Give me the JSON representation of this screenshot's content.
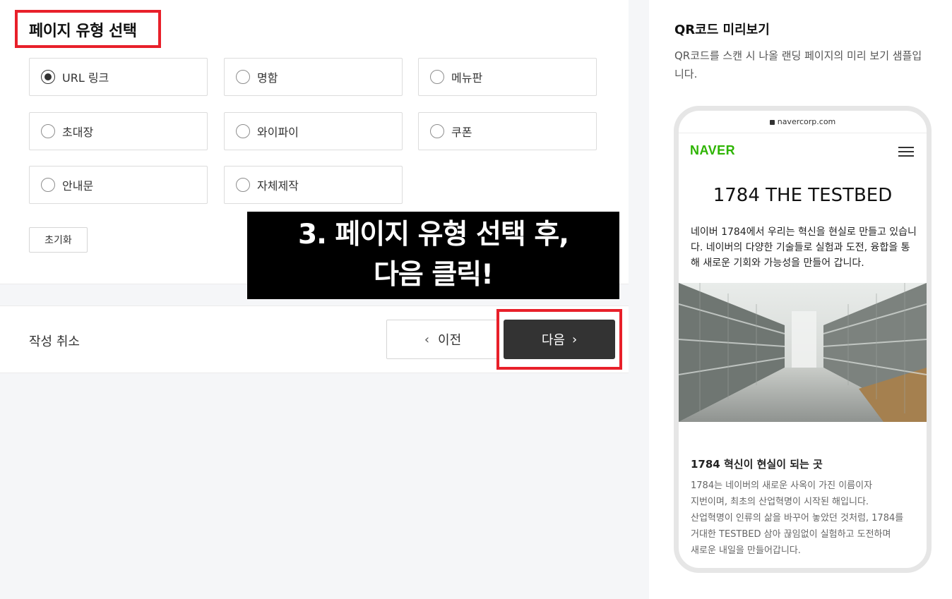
{
  "page_type_section": {
    "title": "페이지 유형 선택",
    "options": [
      {
        "label": "URL 링크",
        "checked": true
      },
      {
        "label": "명함",
        "checked": false
      },
      {
        "label": "메뉴판",
        "checked": false
      },
      {
        "label": "초대장",
        "checked": false
      },
      {
        "label": "와이파이",
        "checked": false
      },
      {
        "label": "쿠폰",
        "checked": false
      },
      {
        "label": "안내문",
        "checked": false
      },
      {
        "label": "자체제작",
        "checked": false
      }
    ],
    "reset_label": "초기화"
  },
  "annotation": {
    "line1": "3. 페이지 유형 선택 후,",
    "line2": "다음 클릭!"
  },
  "footer": {
    "cancel_label": "작성 취소",
    "prev_label": "이전",
    "next_label": "다음"
  },
  "preview": {
    "title": "QR코드 미리보기",
    "description": "QR코드를 스캔 시 나올 랜딩 페이지의 미리 보기 샘플입니다.",
    "phone": {
      "url": "navercorp.com",
      "logo": "NAVER",
      "heading": "1784 THE TESTBED",
      "intro": "네이버 1784에서 우리는 혁신을 현실로 만들고 있습니다. 네이버의 다양한 기술들로 실험과 도전, 융합을 통해 새로운 기회와 가능성을 만들어 갑니다.",
      "subheading": "1784 혁신이 현실이 되는 곳",
      "body_lines": [
        "1784는 네이버의 새로운 사옥이 가진 이름이자",
        "지번이며, 최초의 산업혁명이 시작된 해입니다.",
        "산업혁명이 인류의 삶을 바꾸어 놓았던 것처럼, 1784를",
        "거대한 TESTBED 삼아 끊임없이 실험하고 도전하며",
        "새로운 내일을 만들어갑니다."
      ]
    }
  },
  "colors": {
    "highlight_border": "#e8202a",
    "next_button_bg": "#333333",
    "naver_green": "#2db400",
    "page_bg": "#f5f6f8"
  }
}
